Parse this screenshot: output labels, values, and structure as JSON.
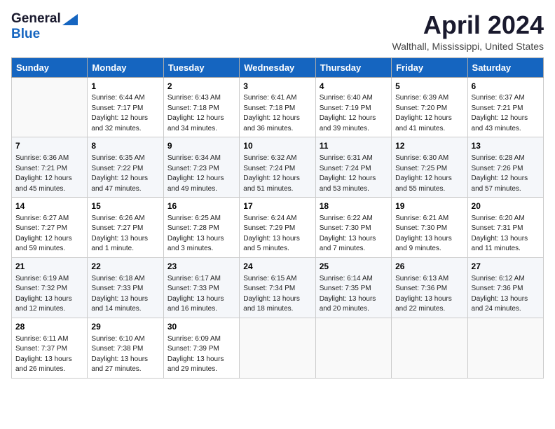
{
  "logo": {
    "general": "General",
    "blue": "Blue"
  },
  "title": "April 2024",
  "location": "Walthall, Mississippi, United States",
  "days_of_week": [
    "Sunday",
    "Monday",
    "Tuesday",
    "Wednesday",
    "Thursday",
    "Friday",
    "Saturday"
  ],
  "weeks": [
    [
      {
        "day": "",
        "sunrise": "",
        "sunset": "",
        "daylight": ""
      },
      {
        "day": "1",
        "sunrise": "Sunrise: 6:44 AM",
        "sunset": "Sunset: 7:17 PM",
        "daylight": "Daylight: 12 hours and 32 minutes."
      },
      {
        "day": "2",
        "sunrise": "Sunrise: 6:43 AM",
        "sunset": "Sunset: 7:18 PM",
        "daylight": "Daylight: 12 hours and 34 minutes."
      },
      {
        "day": "3",
        "sunrise": "Sunrise: 6:41 AM",
        "sunset": "Sunset: 7:18 PM",
        "daylight": "Daylight: 12 hours and 36 minutes."
      },
      {
        "day": "4",
        "sunrise": "Sunrise: 6:40 AM",
        "sunset": "Sunset: 7:19 PM",
        "daylight": "Daylight: 12 hours and 39 minutes."
      },
      {
        "day": "5",
        "sunrise": "Sunrise: 6:39 AM",
        "sunset": "Sunset: 7:20 PM",
        "daylight": "Daylight: 12 hours and 41 minutes."
      },
      {
        "day": "6",
        "sunrise": "Sunrise: 6:37 AM",
        "sunset": "Sunset: 7:21 PM",
        "daylight": "Daylight: 12 hours and 43 minutes."
      }
    ],
    [
      {
        "day": "7",
        "sunrise": "Sunrise: 6:36 AM",
        "sunset": "Sunset: 7:21 PM",
        "daylight": "Daylight: 12 hours and 45 minutes."
      },
      {
        "day": "8",
        "sunrise": "Sunrise: 6:35 AM",
        "sunset": "Sunset: 7:22 PM",
        "daylight": "Daylight: 12 hours and 47 minutes."
      },
      {
        "day": "9",
        "sunrise": "Sunrise: 6:34 AM",
        "sunset": "Sunset: 7:23 PM",
        "daylight": "Daylight: 12 hours and 49 minutes."
      },
      {
        "day": "10",
        "sunrise": "Sunrise: 6:32 AM",
        "sunset": "Sunset: 7:24 PM",
        "daylight": "Daylight: 12 hours and 51 minutes."
      },
      {
        "day": "11",
        "sunrise": "Sunrise: 6:31 AM",
        "sunset": "Sunset: 7:24 PM",
        "daylight": "Daylight: 12 hours and 53 minutes."
      },
      {
        "day": "12",
        "sunrise": "Sunrise: 6:30 AM",
        "sunset": "Sunset: 7:25 PM",
        "daylight": "Daylight: 12 hours and 55 minutes."
      },
      {
        "day": "13",
        "sunrise": "Sunrise: 6:28 AM",
        "sunset": "Sunset: 7:26 PM",
        "daylight": "Daylight: 12 hours and 57 minutes."
      }
    ],
    [
      {
        "day": "14",
        "sunrise": "Sunrise: 6:27 AM",
        "sunset": "Sunset: 7:27 PM",
        "daylight": "Daylight: 12 hours and 59 minutes."
      },
      {
        "day": "15",
        "sunrise": "Sunrise: 6:26 AM",
        "sunset": "Sunset: 7:27 PM",
        "daylight": "Daylight: 13 hours and 1 minute."
      },
      {
        "day": "16",
        "sunrise": "Sunrise: 6:25 AM",
        "sunset": "Sunset: 7:28 PM",
        "daylight": "Daylight: 13 hours and 3 minutes."
      },
      {
        "day": "17",
        "sunrise": "Sunrise: 6:24 AM",
        "sunset": "Sunset: 7:29 PM",
        "daylight": "Daylight: 13 hours and 5 minutes."
      },
      {
        "day": "18",
        "sunrise": "Sunrise: 6:22 AM",
        "sunset": "Sunset: 7:30 PM",
        "daylight": "Daylight: 13 hours and 7 minutes."
      },
      {
        "day": "19",
        "sunrise": "Sunrise: 6:21 AM",
        "sunset": "Sunset: 7:30 PM",
        "daylight": "Daylight: 13 hours and 9 minutes."
      },
      {
        "day": "20",
        "sunrise": "Sunrise: 6:20 AM",
        "sunset": "Sunset: 7:31 PM",
        "daylight": "Daylight: 13 hours and 11 minutes."
      }
    ],
    [
      {
        "day": "21",
        "sunrise": "Sunrise: 6:19 AM",
        "sunset": "Sunset: 7:32 PM",
        "daylight": "Daylight: 13 hours and 12 minutes."
      },
      {
        "day": "22",
        "sunrise": "Sunrise: 6:18 AM",
        "sunset": "Sunset: 7:33 PM",
        "daylight": "Daylight: 13 hours and 14 minutes."
      },
      {
        "day": "23",
        "sunrise": "Sunrise: 6:17 AM",
        "sunset": "Sunset: 7:33 PM",
        "daylight": "Daylight: 13 hours and 16 minutes."
      },
      {
        "day": "24",
        "sunrise": "Sunrise: 6:15 AM",
        "sunset": "Sunset: 7:34 PM",
        "daylight": "Daylight: 13 hours and 18 minutes."
      },
      {
        "day": "25",
        "sunrise": "Sunrise: 6:14 AM",
        "sunset": "Sunset: 7:35 PM",
        "daylight": "Daylight: 13 hours and 20 minutes."
      },
      {
        "day": "26",
        "sunrise": "Sunrise: 6:13 AM",
        "sunset": "Sunset: 7:36 PM",
        "daylight": "Daylight: 13 hours and 22 minutes."
      },
      {
        "day": "27",
        "sunrise": "Sunrise: 6:12 AM",
        "sunset": "Sunset: 7:36 PM",
        "daylight": "Daylight: 13 hours and 24 minutes."
      }
    ],
    [
      {
        "day": "28",
        "sunrise": "Sunrise: 6:11 AM",
        "sunset": "Sunset: 7:37 PM",
        "daylight": "Daylight: 13 hours and 26 minutes."
      },
      {
        "day": "29",
        "sunrise": "Sunrise: 6:10 AM",
        "sunset": "Sunset: 7:38 PM",
        "daylight": "Daylight: 13 hours and 27 minutes."
      },
      {
        "day": "30",
        "sunrise": "Sunrise: 6:09 AM",
        "sunset": "Sunset: 7:39 PM",
        "daylight": "Daylight: 13 hours and 29 minutes."
      },
      {
        "day": "",
        "sunrise": "",
        "sunset": "",
        "daylight": ""
      },
      {
        "day": "",
        "sunrise": "",
        "sunset": "",
        "daylight": ""
      },
      {
        "day": "",
        "sunrise": "",
        "sunset": "",
        "daylight": ""
      },
      {
        "day": "",
        "sunrise": "",
        "sunset": "",
        "daylight": ""
      }
    ]
  ]
}
